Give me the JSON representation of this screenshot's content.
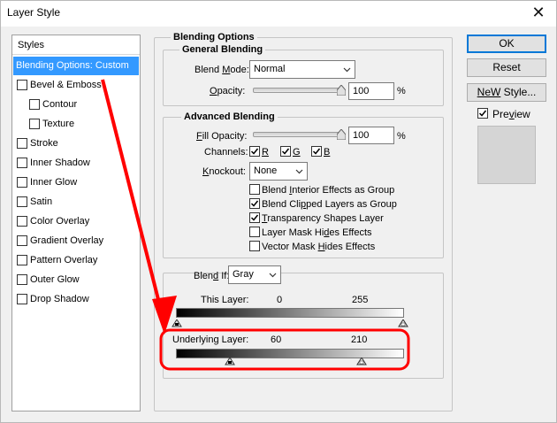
{
  "window": {
    "title": "Layer Style",
    "close_glyph": "✕"
  },
  "styles_list": {
    "header": "Styles",
    "items": [
      {
        "label": "Blending Options: Custom",
        "selected": true,
        "checkbox": false,
        "checked": false
      },
      {
        "label": "Bevel & Emboss",
        "checkbox": true,
        "checked": false
      },
      {
        "label": "Contour",
        "checkbox": true,
        "checked": false,
        "sub": true
      },
      {
        "label": "Texture",
        "checkbox": true,
        "checked": false,
        "sub": true
      },
      {
        "label": "Stroke",
        "checkbox": true,
        "checked": false
      },
      {
        "label": "Inner Shadow",
        "checkbox": true,
        "checked": false
      },
      {
        "label": "Inner Glow",
        "checkbox": true,
        "checked": false
      },
      {
        "label": "Satin",
        "checkbox": true,
        "checked": false
      },
      {
        "label": "Color Overlay",
        "checkbox": true,
        "checked": false
      },
      {
        "label": "Gradient Overlay",
        "checkbox": true,
        "checked": false
      },
      {
        "label": "Pattern Overlay",
        "checkbox": true,
        "checked": false
      },
      {
        "label": "Outer Glow",
        "checkbox": true,
        "checked": false
      },
      {
        "label": "Drop Shadow",
        "checkbox": true,
        "checked": false
      }
    ]
  },
  "blending": {
    "section_title": "Blending Options",
    "general": {
      "title": "General Blending",
      "blend_mode_label_pre": "Blend ",
      "blend_mode_label_u": "M",
      "blend_mode_label_post": "ode:",
      "blend_mode_value": "Normal",
      "opacity_label_u": "O",
      "opacity_label_post": "pacity:",
      "opacity_value": "100",
      "opacity_unit": "%"
    },
    "advanced": {
      "title": "Advanced Blending",
      "fill_label_u": "F",
      "fill_label_post": "ill Opacity:",
      "fill_value": "100",
      "fill_unit": "%",
      "channels_label": "Channels:",
      "channels": [
        {
          "label": "R",
          "checked": true
        },
        {
          "label": "G",
          "checked": true
        },
        {
          "label": "B",
          "checked": true
        }
      ],
      "knockout_label_u": "K",
      "knockout_label_post": "nockout:",
      "knockout_value": "None",
      "options": [
        {
          "pre": "Blend ",
          "u": "I",
          "post": "nterior Effects as Group",
          "checked": false
        },
        {
          "pre": "Blend Cli",
          "u": "p",
          "post": "ped Layers as Group",
          "checked": true
        },
        {
          "pre": "",
          "u": "T",
          "post": "ransparency Shapes Layer",
          "checked": true
        },
        {
          "pre": "Layer Mask Hi",
          "u": "d",
          "post": "es Effects",
          "checked": false
        },
        {
          "pre": "Vector Mask ",
          "u": "H",
          "post": "ides Effects",
          "checked": false
        }
      ]
    },
    "blend_if": {
      "label_pre": "Blen",
      "label_u": "d",
      "label_post": " If:",
      "value": "Gray",
      "this_layer": {
        "label": "This Layer:",
        "low": "0",
        "high": "255"
      },
      "underlying_layer": {
        "label": "Underlying Layer:",
        "low": "60",
        "high": "210"
      }
    }
  },
  "buttons": {
    "ok": "OK",
    "reset": "Reset",
    "new_style_u": "W",
    "new_style_pre": "Ne",
    "new_style_post": " Style...",
    "preview_u": "v",
    "preview_pre": "Pre",
    "preview_post": "iew",
    "preview_checked": true
  },
  "colors": {
    "selection": "#3399ff",
    "annotation": "#ff0000",
    "default_button_border": "#0078d7"
  }
}
